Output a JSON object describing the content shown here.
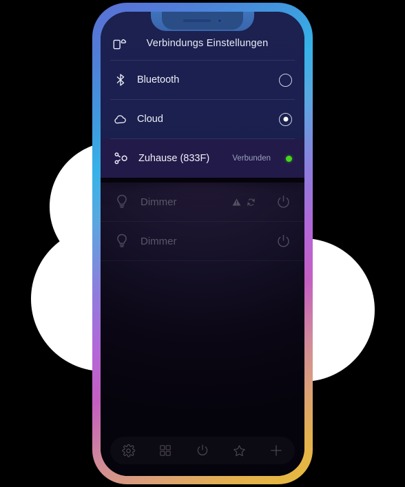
{
  "background": {
    "cloud_color": "#ffffff",
    "page_color": "#000000"
  },
  "device_frame": {
    "gradient_stops": [
      "#5b6fd6",
      "#36b2e8",
      "#8f7ddd",
      "#c45fc2",
      "#dba078",
      "#e8bb3c"
    ],
    "notch": {
      "speaker_name": "earpiece-speaker",
      "camera_name": "front-camera"
    }
  },
  "header": {
    "icon": "device-cloud-icon",
    "title": "Verbindungs Einstellungen"
  },
  "connections": [
    {
      "icon": "bluetooth-icon",
      "label": "Bluetooth",
      "selected": false,
      "status": "",
      "active": false
    },
    {
      "icon": "cloud-icon",
      "label": "Cloud",
      "selected": true,
      "status": "",
      "active": false
    },
    {
      "icon": "network-hub-icon",
      "label": "Zuhause (833F)",
      "selected": null,
      "status": "Verbunden",
      "status_color": "#46d71a",
      "active": true
    }
  ],
  "devices": [
    {
      "icon": "lightbulb-icon",
      "name": "Dimmer",
      "flags": [
        "warning-icon",
        "refresh-icon"
      ],
      "power_icon": "power-icon"
    },
    {
      "icon": "lightbulb-icon",
      "name": "Dimmer",
      "flags": [],
      "power_icon": "power-icon"
    }
  ],
  "bottom_nav": [
    {
      "icon": "gear-icon",
      "name": "settings"
    },
    {
      "icon": "grid-icon",
      "name": "dashboard"
    },
    {
      "icon": "power-icon",
      "name": "scenes"
    },
    {
      "icon": "star-icon",
      "name": "favorites"
    },
    {
      "icon": "plus-icon",
      "name": "add"
    }
  ]
}
